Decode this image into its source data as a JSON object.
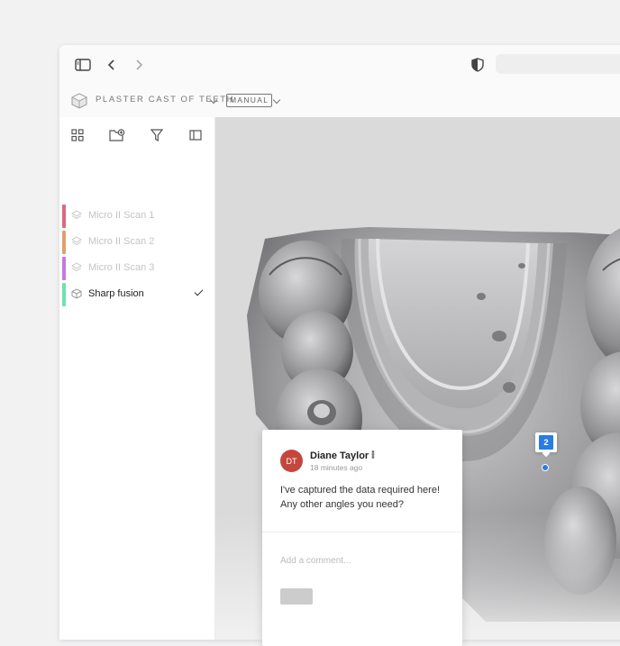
{
  "titlebar": {
    "icons": [
      "sidebar-toggle-icon",
      "chevron-left-icon",
      "chevron-right-icon",
      "shield-icon"
    ]
  },
  "project": {
    "title": "PLASTER CAST OF TEETH",
    "mode": "MANUAL"
  },
  "sidebar": {
    "toolbar_icons": [
      "grid-icon",
      "add-folder-icon",
      "filter-icon",
      "panel-icon"
    ],
    "layers": [
      {
        "label": "Micro II Scan 1",
        "color": "#d9697f",
        "active": false
      },
      {
        "label": "Micro II Scan 2",
        "color": "#e09f6f",
        "active": false
      },
      {
        "label": "Micro II Scan 3",
        "color": "#c47ae0",
        "active": false
      },
      {
        "label": "Sharp fusion",
        "color": "#6fe0b2",
        "active": true
      }
    ]
  },
  "comment": {
    "initials": "DT",
    "author": "Diane Taylor",
    "time": "18 minutes ago",
    "body": "I've captured the data required here! Any other angles you need?",
    "placeholder": "Add a comment..."
  },
  "annotation_pin": {
    "number": "2",
    "color": "#2a7be4"
  }
}
